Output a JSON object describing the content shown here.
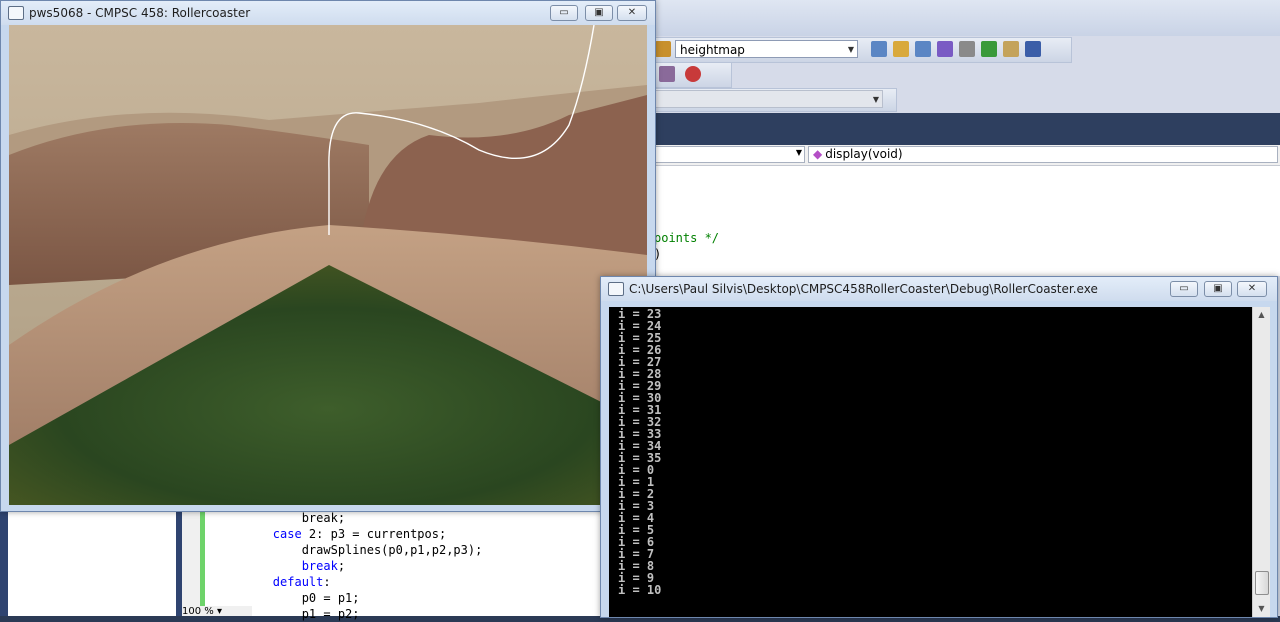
{
  "vs": {
    "config_combo": "heightmap",
    "nav_function": "display(void)",
    "editor_top_lines": [
      "points */",
      ")"
    ],
    "editor_lines": [
      {
        "text": "            break;",
        "kw": false
      },
      {
        "text": "        case 2: p3 = currentpos;",
        "kw": true
      },
      {
        "text": "            drawSplines(p0,p1,p2,p3);",
        "kw": false
      },
      {
        "text": "            break;",
        "kw": true
      },
      {
        "text": "        default:",
        "kw": true
      },
      {
        "text": "            p0 = p1;",
        "kw": false
      },
      {
        "text": "            p1 = p2;",
        "kw": false
      }
    ],
    "zoom_label": "100 %"
  },
  "gl_window": {
    "title": "pws5068 - CMPSC 458: Rollercoaster",
    "minimize": "▭",
    "restore": "▣",
    "close": "✕"
  },
  "console_window": {
    "title": "C:\\Users\\Paul Silvis\\Desktop\\CMPSC458RollerCoaster\\Debug\\RollerCoaster.exe",
    "lines": [
      "i = 23",
      "i = 24",
      "i = 25",
      "i = 26",
      "i = 27",
      "i = 28",
      "i = 29",
      "i = 30",
      "i = 31",
      "i = 32",
      "i = 33",
      "i = 34",
      "i = 35",
      "i = 0",
      "i = 1",
      "i = 2",
      "i = 3",
      "i = 4",
      "i = 5",
      "i = 6",
      "i = 7",
      "i = 8",
      "i = 9",
      "i = 10"
    ],
    "scroll_up": "▲",
    "scroll_down": "▼"
  },
  "colors": {
    "terrain_rock": "#a8775a",
    "terrain_grass": "#2f4d22",
    "console_bg": "#000000",
    "console_text": "#c0c0c0"
  }
}
